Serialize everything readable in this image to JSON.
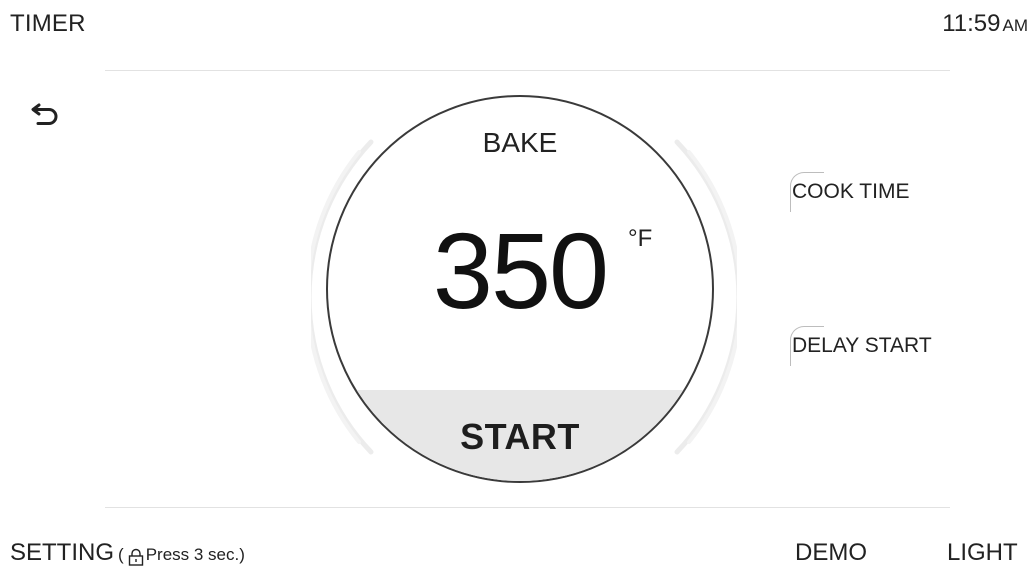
{
  "header": {
    "title": "TIMER",
    "time": "11:59",
    "ampm": "AM"
  },
  "dial": {
    "mode": "BAKE",
    "temperature": "350",
    "unit": "°F",
    "start_label": "START"
  },
  "side_options": {
    "cook_time": "COOK TIME",
    "delay_start": "DELAY START"
  },
  "footer": {
    "setting_label": "SETTING",
    "setting_hint_open": "(",
    "setting_hint_text": "Press 3 sec.)",
    "demo_label": "DEMO",
    "light_label": "LIGHT"
  },
  "icons": {
    "back": "back-arrow-icon",
    "lock": "lock-icon"
  }
}
